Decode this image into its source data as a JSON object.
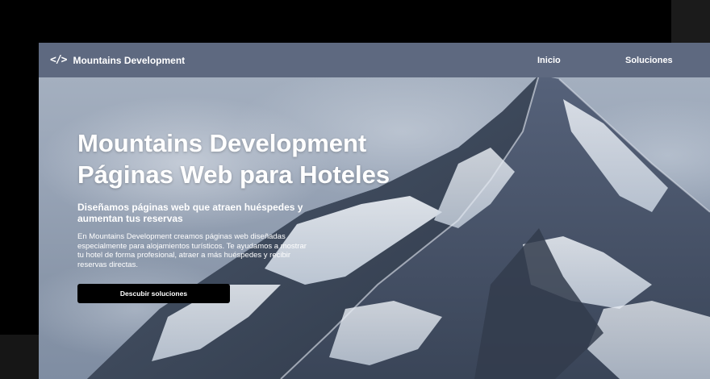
{
  "navbar": {
    "brand_icon": "</>",
    "brand_name": "Mountains Development",
    "links": [
      {
        "label": "Inicio"
      },
      {
        "label": "Soluciones"
      }
    ]
  },
  "hero": {
    "title_line1": "Mountains Development",
    "title_line2": "Páginas Web para Hoteles",
    "subtitle": "Diseñamos páginas web que atraen huéspedes y aumentan tus reservas",
    "description": "En Mountains Development creamos páginas web diseñadas especialmente para alojamientos turísticos. Te ayudamos a mostrar tu hotel de forma profesional, atraer a más huéspedes y recibir reservas directas.",
    "cta_label": "Descubir soluciones"
  },
  "colors": {
    "navbar_bg": "#5e6980",
    "cta_bg": "#000000",
    "text": "#ffffff"
  },
  "icons": {
    "brand": "code-icon"
  }
}
